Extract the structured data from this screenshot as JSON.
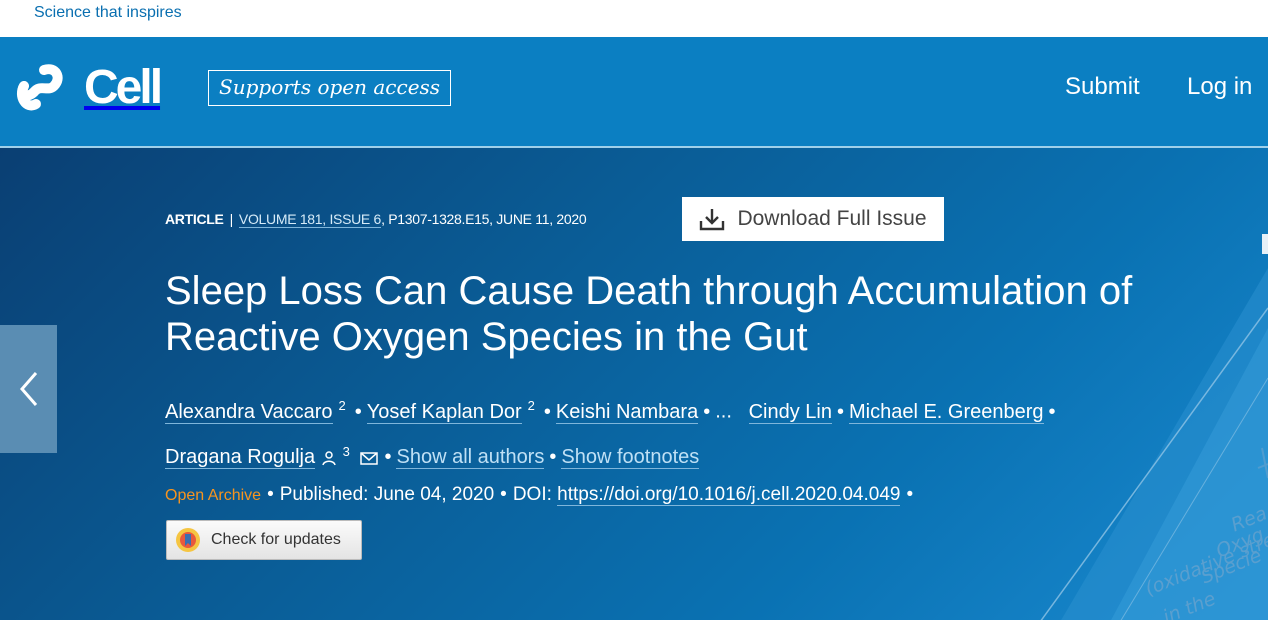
{
  "topbar": {
    "tagline": "Science that inspires"
  },
  "header": {
    "logo_text": "Cell",
    "open_access_badge": "Supports open access",
    "nav": {
      "submit": "Submit",
      "login": "Log in"
    }
  },
  "article": {
    "type": "ARTICLE",
    "separator": "|",
    "volume_issue": "VOLUME 181, ISSUE 6",
    "pages_date": ", P1307-1328.E15, JUNE 11, 2020",
    "download_label": "Download Full Issue",
    "title": "Sleep Loss Can Cause Death through Accumulation of Reactive Oxygen Species in the Gut",
    "authors": [
      {
        "name": "Alexandra Vaccaro",
        "sup": "2"
      },
      {
        "name": "Yosef Kaplan Dor",
        "sup": "2"
      },
      {
        "name": "Keishi Nambara",
        "sup": ""
      },
      {
        "name": "Cindy Lin",
        "sup": ""
      },
      {
        "name": "Michael E. Greenberg",
        "sup": ""
      },
      {
        "name": "Dragana Rogulja",
        "sup": "3"
      }
    ],
    "ellipsis": "...",
    "show_all_authors": "Show all authors",
    "show_footnotes": "Show footnotes",
    "access": "Open Archive",
    "published": "Published: June 04, 2020",
    "doi_label": "DOI:",
    "doi_link": "https://doi.org/10.1016/j.cell.2020.04.049",
    "check_updates": "Check for updates"
  },
  "cover_text": [
    "Rea",
    "Oxyg",
    "Specie",
    "(oxidative stre",
    "in the "
  ],
  "icons": {
    "logo": "cell-logo-icon",
    "download": "download-icon",
    "prev": "chevron-left-icon",
    "contact": "person-icon",
    "email": "envelope-icon",
    "updates": "crossmark-icon"
  },
  "colors": {
    "header_blue": "#0b7fc2",
    "open_archive": "#f7941e",
    "link": "#0a6fb0"
  }
}
